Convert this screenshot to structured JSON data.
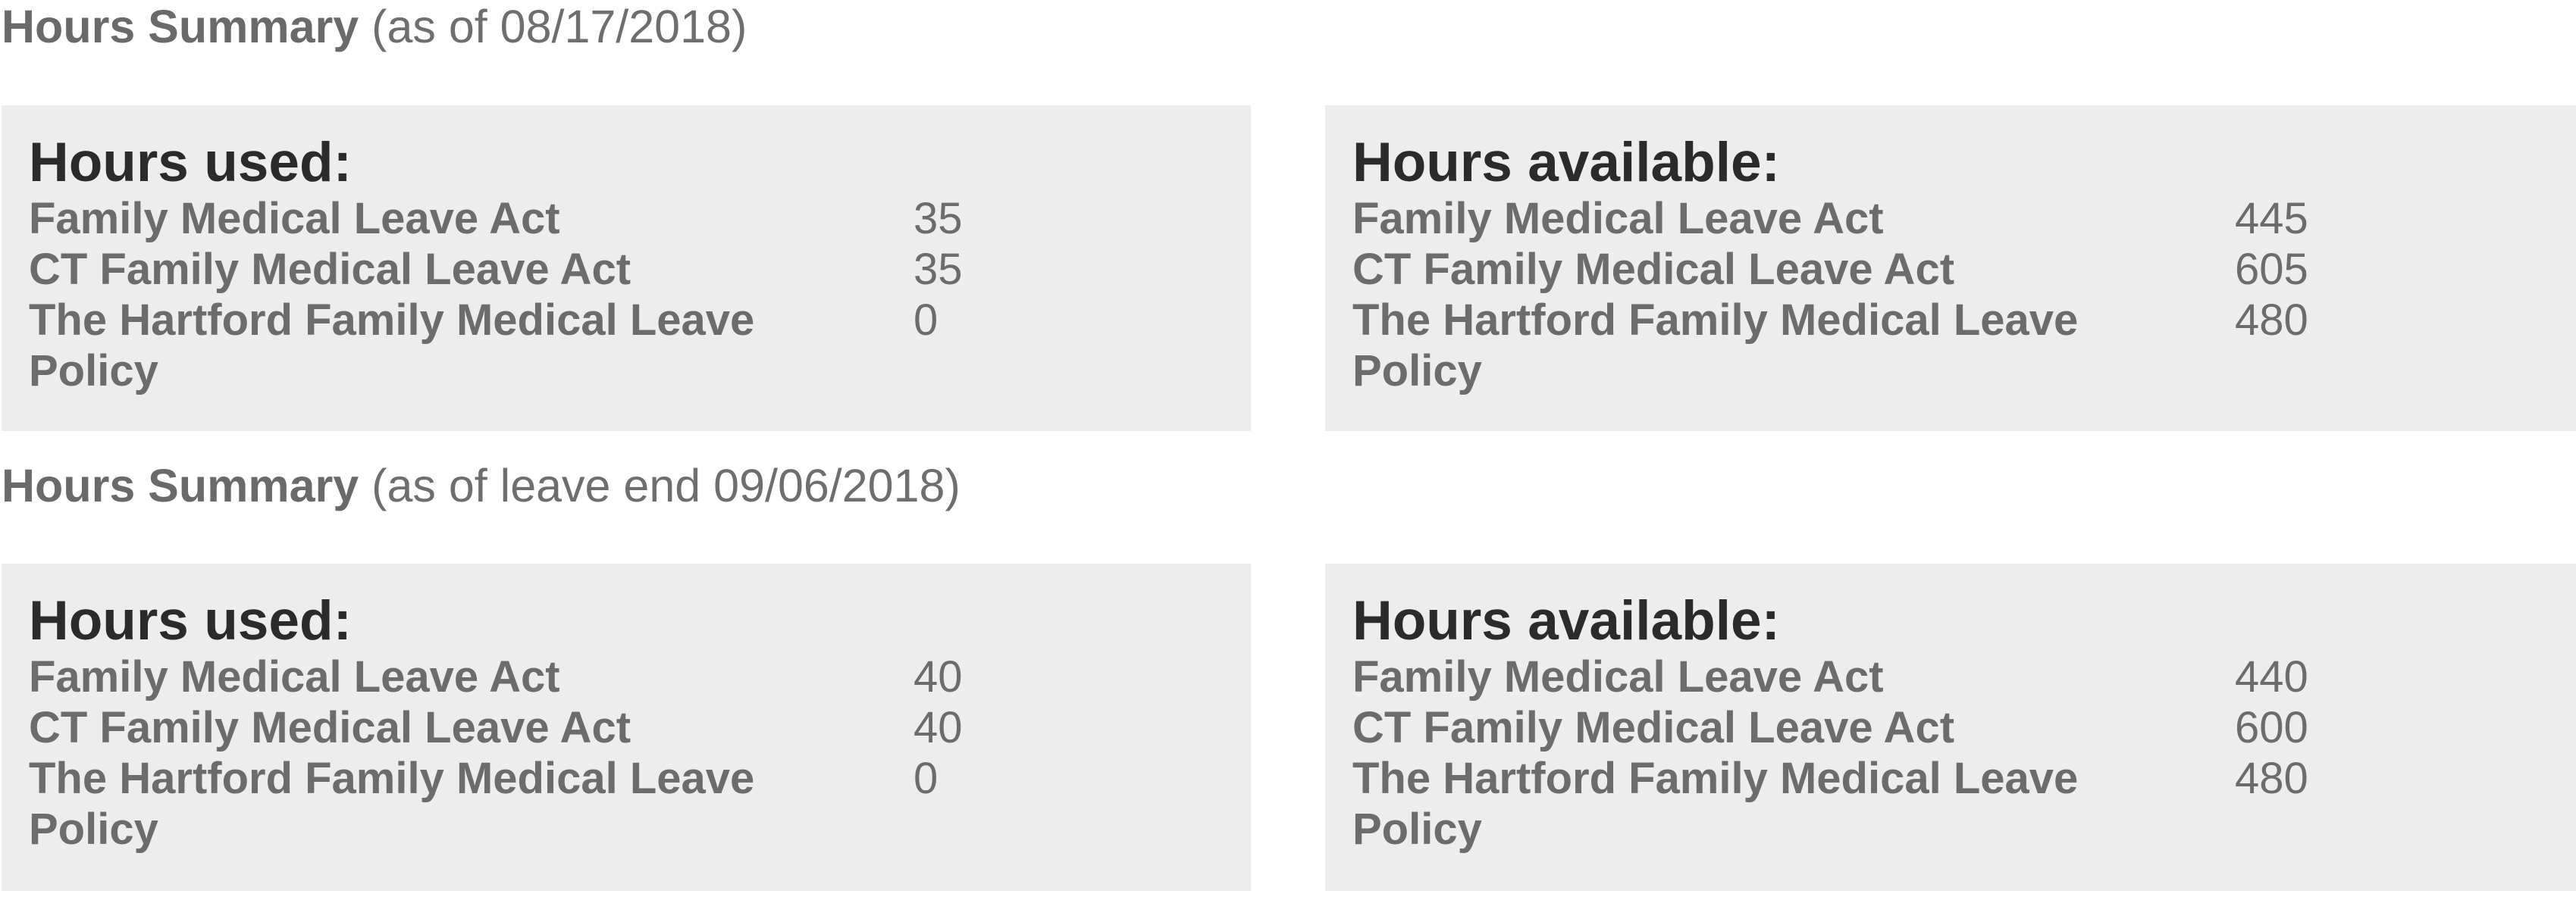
{
  "sections": [
    {
      "heading_bold": "Hours Summary",
      "heading_rest": " (as of 08/17/2018)",
      "used": {
        "title": "Hours used:",
        "rows": [
          {
            "label": "Family Medical Leave Act",
            "value": "35"
          },
          {
            "label": "CT Family Medical Leave Act",
            "value": "35"
          },
          {
            "label": "The Hartford Family Medical Leave Policy",
            "value": "0"
          }
        ]
      },
      "available": {
        "title": "Hours available:",
        "rows": [
          {
            "label": "Family Medical Leave Act",
            "value": "445"
          },
          {
            "label": "CT Family Medical Leave Act",
            "value": "605"
          },
          {
            "label": "The Hartford Family Medical Leave Policy",
            "value": "480"
          }
        ]
      }
    },
    {
      "heading_bold": "Hours Summary",
      "heading_rest": " (as of leave end 09/06/2018)",
      "used": {
        "title": "Hours used:",
        "rows": [
          {
            "label": "Family Medical Leave Act",
            "value": "40"
          },
          {
            "label": "CT Family Medical Leave Act",
            "value": "40"
          },
          {
            "label": "The Hartford Family Medical Leave Policy",
            "value": "0"
          }
        ]
      },
      "available": {
        "title": "Hours available:",
        "rows": [
          {
            "label": "Family Medical Leave Act",
            "value": "440"
          },
          {
            "label": "CT Family Medical Leave Act",
            "value": "600"
          },
          {
            "label": "The Hartford Family Medical Leave Policy",
            "value": "480"
          }
        ]
      }
    }
  ]
}
